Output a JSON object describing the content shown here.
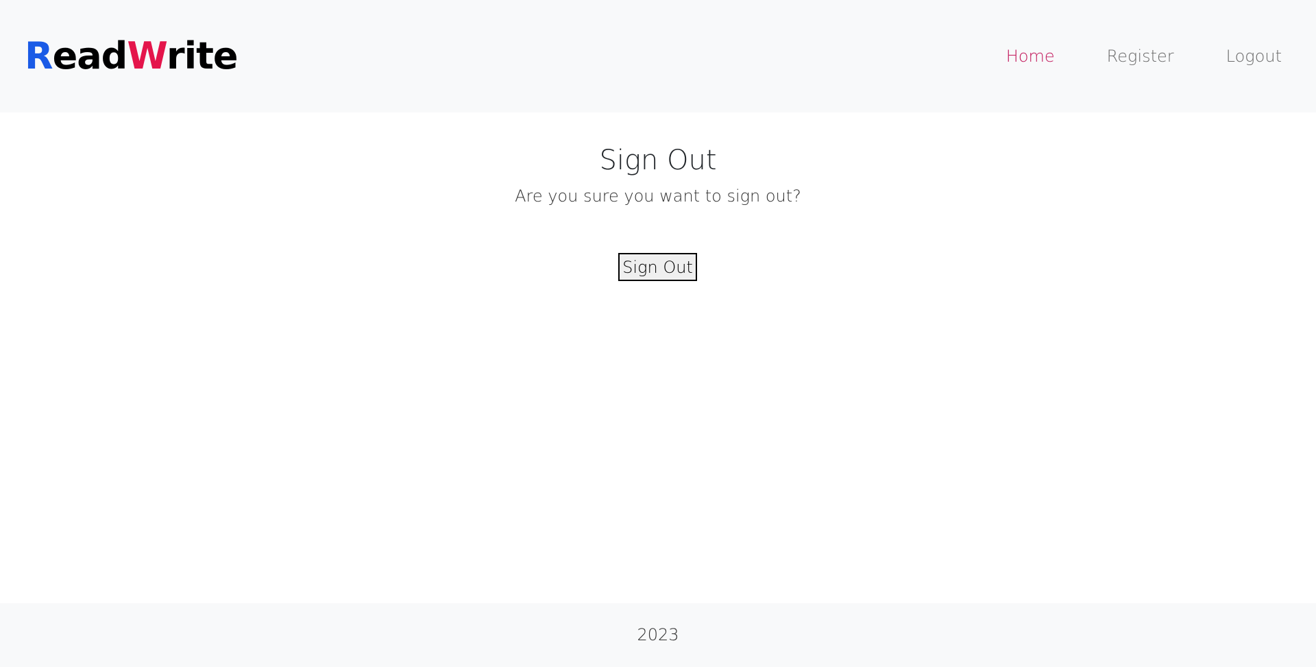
{
  "header": {
    "logo": {
      "part1": "R",
      "part2": "ead",
      "part3": "W",
      "part4": "rite",
      "color_r": "#1a5be6",
      "color_w": "#e4154b"
    },
    "nav": {
      "home": "Home",
      "register": "Register",
      "logout": "Logout",
      "active_item": "Home",
      "active_color": "#c2185b"
    }
  },
  "main": {
    "title": "Sign Out",
    "prompt": "Are you sure you want to sign out?",
    "signout_button": "Sign Out"
  },
  "footer": {
    "year": "2023"
  }
}
